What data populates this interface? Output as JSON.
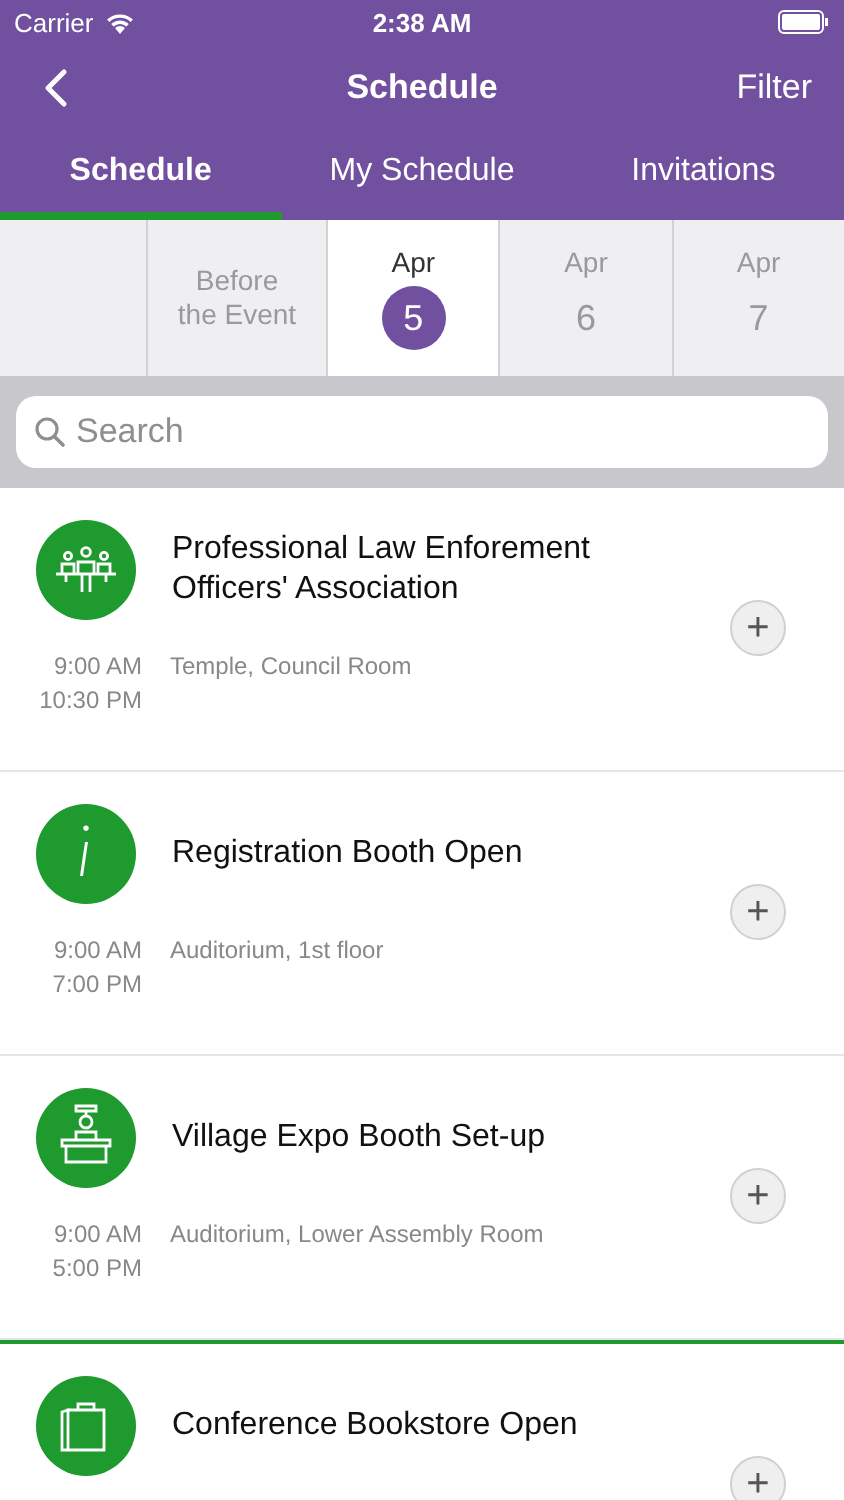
{
  "status_bar": {
    "carrier": "Carrier",
    "time": "2:38 AM"
  },
  "nav": {
    "title": "Schedule",
    "action": "Filter"
  },
  "tabs": [
    {
      "label": "Schedule",
      "selected": true
    },
    {
      "label": "My Schedule",
      "selected": false
    },
    {
      "label": "Invitations",
      "selected": false
    }
  ],
  "dates": [
    {
      "kind": "blank",
      "selected": false
    },
    {
      "kind": "label",
      "label": "Before the Event",
      "selected": false
    },
    {
      "kind": "day",
      "month": "Apr",
      "day": "5",
      "selected": true
    },
    {
      "kind": "day",
      "month": "Apr",
      "day": "6",
      "selected": false
    },
    {
      "kind": "day",
      "month": "Apr",
      "day": "7",
      "selected": false
    }
  ],
  "search": {
    "placeholder": "Search"
  },
  "events": [
    {
      "kind": "event",
      "title": "Professional Law Enforement Officers' Association",
      "start": "9:00 AM",
      "end": "10:30 PM",
      "location": "Temple, Council Room",
      "add": "+"
    },
    {
      "kind": "event",
      "title": "Registration Booth Open",
      "start": "9:00 AM",
      "end": "7:00 PM",
      "location": "Auditorium, 1st floor",
      "add": "+"
    },
    {
      "kind": "event",
      "title": "Village Expo Booth Set-up",
      "start": "9:00 AM",
      "end": "5:00 PM",
      "location": "Auditorium, Lower Assembly Room",
      "add": "+"
    },
    {
      "kind": "now-line"
    },
    {
      "kind": "event",
      "title": "Conference Bookstore Open",
      "add": "+"
    }
  ]
}
